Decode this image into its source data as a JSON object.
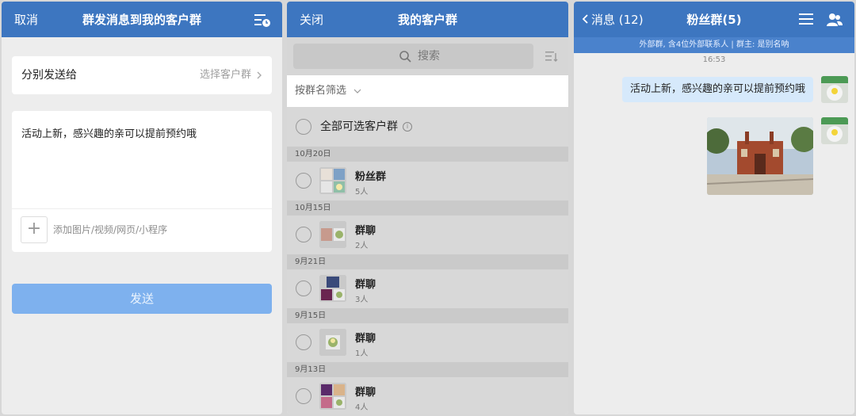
{
  "colors": {
    "nav_blue": "#3d76c0",
    "send_disabled": "#7eb1ee",
    "bubble": "#d6e9fb",
    "background": "#ededed"
  },
  "compose": {
    "cancel_label": "取消",
    "title": "群发消息到我的客户群",
    "history_icon": "list-clock-icon",
    "recipient_label": "分别发送给",
    "recipient_placeholder": "选择客户群",
    "message": "活动上新，感兴趣的亲可以提前预约哦",
    "add_media_icon": "plus-icon",
    "add_media_label": "添加图片/视频/网页/小程序",
    "send_label": "发送"
  },
  "picker": {
    "close_label": "关闭",
    "title": "我的客户群",
    "search_placeholder": "搜索",
    "filter_label": "按群名筛选",
    "select_all_label": "全部可选客户群",
    "sections": [
      {
        "date": "10月20日",
        "groups": [
          {
            "name": "粉丝群",
            "count": "5人"
          }
        ]
      },
      {
        "date": "10月15日",
        "groups": [
          {
            "name": "群聊",
            "count": "2人"
          }
        ]
      },
      {
        "date": "9月21日",
        "groups": [
          {
            "name": "群聊",
            "count": "3人"
          }
        ]
      },
      {
        "date": "9月15日",
        "groups": [
          {
            "name": "群聊",
            "count": "1人"
          }
        ]
      },
      {
        "date": "9月13日",
        "groups": [
          {
            "name": "群聊",
            "count": "4人"
          }
        ]
      }
    ]
  },
  "chat": {
    "back_label": "消息 (12)",
    "title": "粉丝群(5)",
    "info_bar": "外部群, 含4位外部联系人 | 群主: 是别名呐",
    "time": "16:53",
    "message": "活动上新，感兴趣的亲可以提前预约哦",
    "image_alt": "photo-message"
  }
}
